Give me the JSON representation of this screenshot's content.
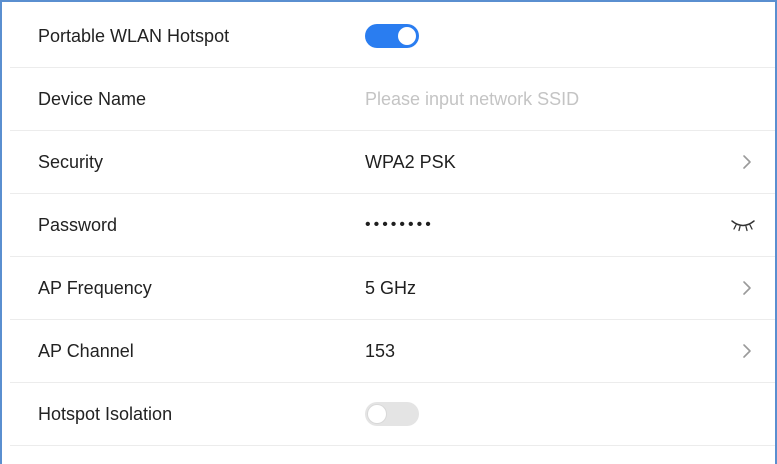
{
  "settings": {
    "hotspot": {
      "label": "Portable WLAN Hotspot",
      "enabled": true
    },
    "device_name": {
      "label": "Device Name",
      "placeholder": "Please input network SSID"
    },
    "security": {
      "label": "Security",
      "value": "WPA2 PSK",
      "icon": "chevron-right-icon"
    },
    "password": {
      "label": "Password",
      "value": "••••••••",
      "icon": "eye-closed-icon"
    },
    "ap_frequency": {
      "label": "AP Frequency",
      "value": "5 GHz",
      "icon": "chevron-right-icon"
    },
    "ap_channel": {
      "label": "AP Channel",
      "value": "153",
      "icon": "chevron-right-icon"
    },
    "isolation": {
      "label": "Hotspot Isolation",
      "enabled": false
    }
  },
  "colors": {
    "accent": "#2a7df0",
    "toggle_off": "#e4e4e4",
    "placeholder": "#c4c4c4",
    "divider": "#ececec",
    "frame": "#5a8fd0"
  }
}
